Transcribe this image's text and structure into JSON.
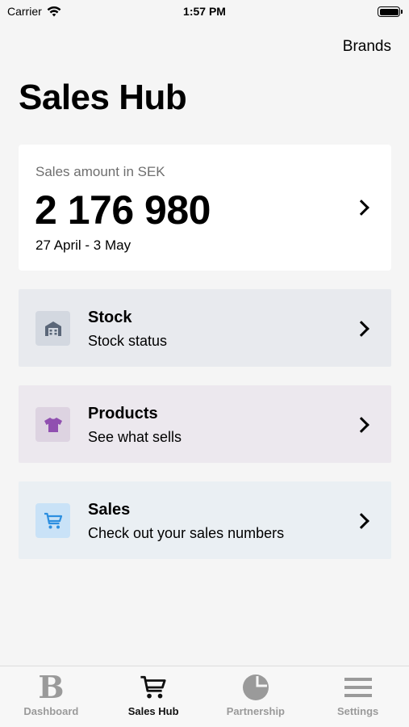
{
  "status_bar": {
    "carrier": "Carrier",
    "time": "1:57 PM"
  },
  "header": {
    "brands_label": "Brands",
    "title": "Sales Hub"
  },
  "sales_card": {
    "label": "Sales amount in SEK",
    "amount": "2 176 980",
    "period": "27 April - 3 May"
  },
  "cards": [
    {
      "title": "Stock",
      "subtitle": "Stock status",
      "icon": "warehouse-icon",
      "bg": "#e8eaee",
      "icon_bg": "#d3d8e0",
      "icon_color": "#5b6779"
    },
    {
      "title": "Products",
      "subtitle": "See what sells",
      "icon": "tshirt-icon",
      "bg": "#ece8ee",
      "icon_bg": "#ddd3e1",
      "icon_color": "#9050b0"
    },
    {
      "title": "Sales",
      "subtitle": "Check out your sales numbers",
      "icon": "cart-icon",
      "bg": "#eaeff3",
      "icon_bg": "#c9e2f7",
      "icon_color": "#2d8fe0"
    }
  ],
  "tabs": [
    {
      "label": "Dashboard",
      "icon": "b-logo-icon",
      "active": false
    },
    {
      "label": "Sales Hub",
      "icon": "cart-icon",
      "active": true
    },
    {
      "label": "Partnership",
      "icon": "pie-icon",
      "active": false
    },
    {
      "label": "Settings",
      "icon": "menu-icon",
      "active": false
    }
  ],
  "colors": {
    "background": "#f5f5f5",
    "card": "#ffffff",
    "tab_active": "#111111",
    "tab_inactive": "#9a9a9a"
  }
}
